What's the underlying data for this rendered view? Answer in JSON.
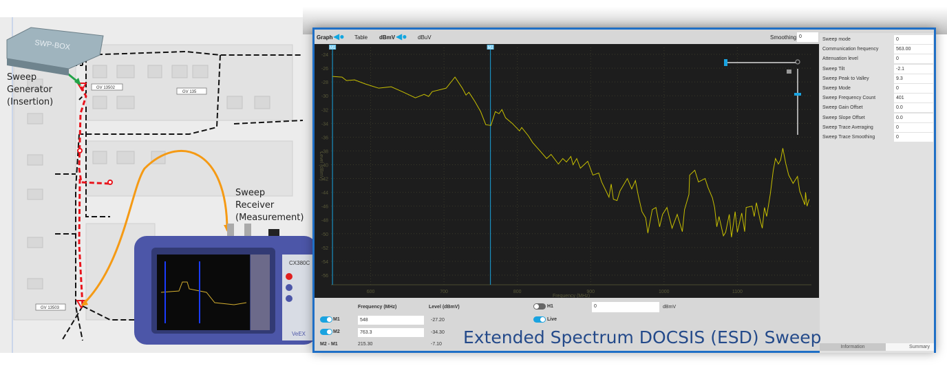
{
  "map": {
    "generator_label": "Sweep\nGenerator\n(Insertion)",
    "receiver_label": "Sweep\nReceiver\n(Measurement)",
    "box_label": "SWP-BOX",
    "node_labels": [
      "GV 13502",
      "GV  135",
      "GV 13503"
    ],
    "device_model": "CX380C",
    "device_brand": "VeEX"
  },
  "toolbar": {
    "graph": "Graph",
    "table": "Table",
    "dbmv": "dBmV",
    "dbuv": "dBuV",
    "smoothing_label": "Smoothing",
    "smoothing_value": "0"
  },
  "properties": [
    {
      "k": "Sweep mode",
      "v": "0"
    },
    {
      "k": "Communication frequency",
      "v": "563.00"
    },
    {
      "k": "Attenuation level",
      "v": "0"
    },
    {
      "k": "Sweep Tilt",
      "v": "-2.1"
    },
    {
      "k": "Sweep Peak to Valley",
      "v": "9.3"
    },
    {
      "k": "Sweep Mode",
      "v": "0"
    },
    {
      "k": "Sweep Frequency Count",
      "v": "401"
    },
    {
      "k": "Sweep Gain Offset",
      "v": "0.0"
    },
    {
      "k": "Sweep Slope Offset",
      "v": "0.0"
    },
    {
      "k": "Sweep Trace Averaging",
      "v": "0"
    },
    {
      "k": "Sweep Trace Smoothing",
      "v": "0"
    }
  ],
  "tabs": {
    "information": "Information",
    "summary": "Summary"
  },
  "markers": {
    "freq_header": "Frequency (MHz)",
    "level_header": "Level (dBmV)",
    "m1": {
      "label": "M1",
      "freq": "548",
      "level": "-27.20",
      "on": true
    },
    "m2": {
      "label": "M2",
      "freq": "763.3",
      "level": "-34.30",
      "on": true
    },
    "diff": {
      "label": "M2 - M1",
      "freq": "215.30",
      "level": "-7.10"
    },
    "h1": {
      "label": "H1",
      "value": "0",
      "unit": "dBmV",
      "on": false
    },
    "live": {
      "label": "Live",
      "on": true
    }
  },
  "caption": "Extended Spectrum DOCSIS (ESD) Sweep",
  "colors": {
    "trace": "#c8c000",
    "marker": "#1a8fc0",
    "accent": "#1aa3e0",
    "border": "#1f6fc6"
  },
  "chart_data": {
    "type": "line",
    "xlabel": "Frequency (MHz)",
    "ylabel": "Level (dBmV)",
    "xlim": [
      546,
      1201
    ],
    "ylim": [
      -57.4,
      -23
    ],
    "xticks": [
      600,
      700,
      800,
      900,
      1000,
      1100
    ],
    "yticks": [
      -24,
      -26,
      -28,
      -30,
      -32,
      -34,
      -36,
      -38,
      -40,
      -42,
      -44,
      -46,
      -48,
      -50,
      -52,
      -54,
      -56
    ],
    "grid": true,
    "marker_lines": [
      {
        "name": "M1",
        "x": 548
      },
      {
        "name": "M2",
        "x": 763.3
      }
    ],
    "series": [
      {
        "x": [
          548,
          561,
          567,
          578,
          593,
          611,
          628,
          643,
          661,
          673,
          679,
          684,
          703,
          715,
          725,
          730,
          734,
          742,
          750,
          757,
          764,
          770,
          775,
          779,
          784,
          793,
          803,
          806,
          815,
          821,
          831,
          840,
          846,
          856,
          862,
          867,
          873,
          876,
          881,
          886,
          896,
          903,
          911,
          915,
          925,
          928,
          931,
          936,
          940,
          950,
          956,
          961,
          965,
          970,
          975,
          978,
          984,
          989,
          994,
          998,
          1004,
          1011,
          1018,
          1025,
          1028,
          1034,
          1035,
          1042,
          1047,
          1056,
          1060,
          1066,
          1069,
          1072,
          1075,
          1081,
          1084,
          1089,
          1092,
          1097,
          1100,
          1106,
          1110,
          1112,
          1120,
          1123,
          1126,
          1131,
          1134,
          1137,
          1140,
          1145,
          1149,
          1152,
          1156,
          1159,
          1162,
          1166,
          1170,
          1176,
          1182,
          1185,
          1192,
          1193,
          1195,
          1198
        ],
        "y": [
          -27.2,
          -27.3,
          -27.8,
          -27.7,
          -28.3,
          -28.9,
          -28.7,
          -29.4,
          -30.3,
          -29.8,
          -30.1,
          -29.4,
          -28.9,
          -27.3,
          -28.9,
          -29.9,
          -29.5,
          -30.8,
          -32.3,
          -34.2,
          -34.3,
          -32.3,
          -32.6,
          -32.0,
          -33.2,
          -34.0,
          -35.1,
          -34.6,
          -35.8,
          -36.8,
          -38.0,
          -39.1,
          -38.5,
          -39.9,
          -39.1,
          -39.6,
          -38.8,
          -40.0,
          -39.1,
          -40.5,
          -39.5,
          -41.5,
          -41.2,
          -42.5,
          -44.7,
          -42.8,
          -45.0,
          -45.2,
          -43.8,
          -42.0,
          -43.5,
          -42.3,
          -44.5,
          -46.8,
          -47.7,
          -49.9,
          -46.5,
          -46.2,
          -49.0,
          -47.2,
          -46.2,
          -49.2,
          -47.2,
          -49.7,
          -46.5,
          -44.3,
          -41.5,
          -40.8,
          -42.5,
          -42.0,
          -43.3,
          -44.8,
          -46.2,
          -49.0,
          -47.5,
          -50.3,
          -49.8,
          -47.2,
          -50.5,
          -46.8,
          -49.8,
          -47.0,
          -49.7,
          -46.2,
          -46.0,
          -47.5,
          -45.5,
          -48.0,
          -49.2,
          -46.2,
          -47.5,
          -44.2,
          -40.8,
          -39.1,
          -39.9,
          -39.3,
          -37.6,
          -39.8,
          -41.5,
          -42.7,
          -41.7,
          -43.8,
          -45.8,
          -44.0,
          -46.0,
          -45.0
        ]
      }
    ]
  }
}
